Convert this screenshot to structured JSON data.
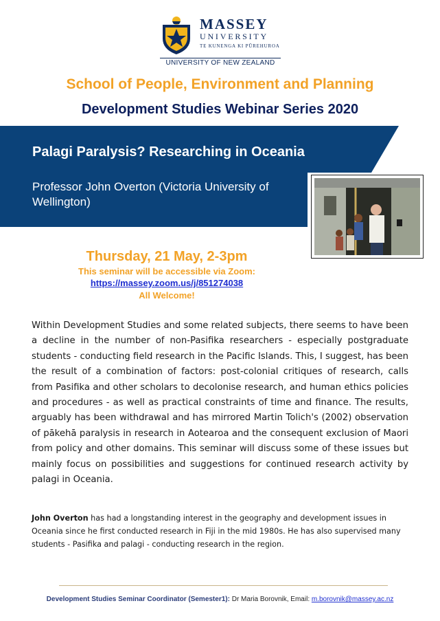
{
  "logo": {
    "name": "MASSEY",
    "subname": "UNIVERSITY",
    "maori": "TE KUNENGA KI PŪREHUROA",
    "country": "UNIVERSITY OF NEW ZEALAND"
  },
  "header": {
    "school": "School of People, Environment and Planning",
    "series": "Development Studies Webinar Series 2020"
  },
  "banner": {
    "title": "Palagi Paralysis? Researching in Oceania",
    "speaker": "Professor John Overton (Victoria University of Wellington)"
  },
  "event": {
    "date": "Thursday, 21 May, 2-3pm",
    "zoom_note": "This seminar will be accessible via Zoom:",
    "zoom_link": "https://massey.zoom.us/j/851274038",
    "welcome": "All Welcome!"
  },
  "abstract": "Within Development Studies and some related subjects, there seems to have been a decline in the number of non-Pasifika researchers - especially postgraduate students - conducting field research in the Pacific Islands. This, I suggest, has been the result of a combination of factors: post-colonial critiques of research, calls from Pasifika and other scholars to decolonise research, and human ethics policies and procedures - as well as practical constraints of time and finance. The results, arguably has been withdrawal and has mirrored Martin Tolich's (2002) observation of pākehā paralysis in research in Aotearoa and the consequent exclusion of Maori from policy and other domains.  This seminar will discuss some of these issues but mainly focus on possibilities and suggestions for continued research activity by palagi in Oceania.",
  "bio": {
    "name": "John Overton",
    "text": " has had a longstanding interest in the geography and development issues in Oceania since he first conducted research in Fiji in the mid 1980s. He has also supervised many students - Pasifika and palagi - conducting research in the region."
  },
  "footer": {
    "role": "Development Studies Seminar Coordinator (Semester1):",
    "contact": " Dr Maria Borovnik, Email: ",
    "email": "m.borovnik@massey.ac.nz"
  },
  "colors": {
    "orange": "#f2a227",
    "navy": "#0d1f5c",
    "banner_blue": "#0b4279",
    "link_blue": "#1f2fd0"
  }
}
